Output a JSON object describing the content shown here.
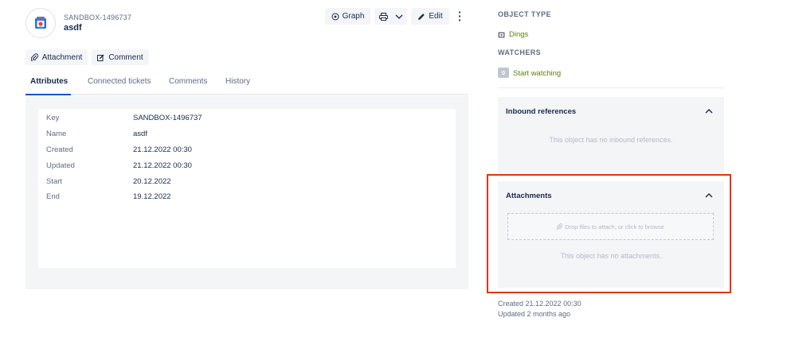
{
  "object": {
    "key": "SANDBOX-1496737",
    "name": "asdf",
    "icon": "object-type-icon"
  },
  "header_actions": {
    "graph_label": "Graph",
    "edit_label": "Edit"
  },
  "actions": {
    "attachment_label": "Attachment",
    "comment_label": "Comment"
  },
  "tabs": [
    {
      "label": "Attributes",
      "active": true
    },
    {
      "label": "Connected tickets",
      "active": false
    },
    {
      "label": "Comments",
      "active": false
    },
    {
      "label": "History",
      "active": false
    }
  ],
  "attributes": [
    {
      "key": "Key",
      "value": "SANDBOX-1496737"
    },
    {
      "key": "Name",
      "value": "asdf"
    },
    {
      "key": "Created",
      "value": "21.12.2022 00:30"
    },
    {
      "key": "Updated",
      "value": "21.12.2022 00:30"
    },
    {
      "key": "Start",
      "value": "20.12.2022"
    },
    {
      "key": "End",
      "value": "19.12.2022"
    }
  ],
  "sidebar": {
    "object_type_heading": "OBJECT TYPE",
    "object_type_value": "Dings",
    "watchers_heading": "WATCHERS",
    "watchers_count": "0",
    "start_watching_label": "Start watching",
    "inbound": {
      "title": "Inbound references",
      "empty_text": "This object has no inbound references."
    },
    "attachments": {
      "title": "Attachments",
      "dropzone_text": "Drop files to attach, or click to browse",
      "empty_text": "This object has no attachments."
    },
    "created_text": "Created 21.12.2022 00:30",
    "updated_text": "Updated 2 months ago"
  },
  "colors": {
    "link_green": "#5b7f0f",
    "highlight_red": "#de350b",
    "tab_active": "#0052cc"
  }
}
